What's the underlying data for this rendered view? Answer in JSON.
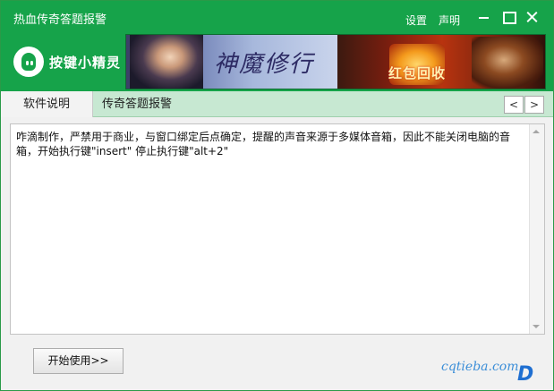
{
  "window": {
    "title": "热血传奇答题报警",
    "settings_label": "设置",
    "about_label": "声明"
  },
  "logo": {
    "text": "按键小精灵"
  },
  "banner": {
    "title_left": "神魔修行",
    "title_right": "红包回收"
  },
  "tabs": [
    {
      "label": "软件说明",
      "active": true
    },
    {
      "label": "传奇答题报警",
      "active": false
    }
  ],
  "tab_nav": {
    "prev": "<",
    "next": ">"
  },
  "content": {
    "description": "咋滴制作，严禁用于商业，与窗口绑定后点确定，提醒的声音来源于多媒体音箱，因此不能关闭电脑的音箱，开始执行键\"insert\" 停止执行键\"alt+2\""
  },
  "actions": {
    "start_label": "开始使用>>"
  },
  "watermark": {
    "site": "cqtieba.com",
    "logo_letter": "D"
  },
  "colors": {
    "brand_green": "#16a34a",
    "tab_strip": "#c7e8d2"
  }
}
